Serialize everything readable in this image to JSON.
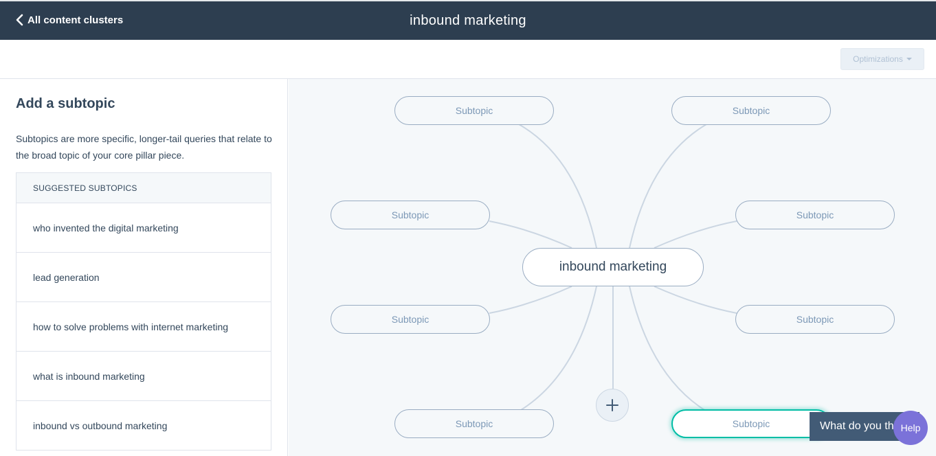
{
  "header": {
    "back_label": "All content clusters",
    "title": "inbound marketing"
  },
  "toolbar": {
    "optimizations_label": "Optimizations"
  },
  "panel": {
    "title": "Add a subtopic",
    "description": "Subtopics are more specific, longer-tail queries that relate to the broad topic of your core pillar piece.",
    "suggested_header": "SUGGESTED SUBTOPICS",
    "suggestions": [
      "who invented the digital marketing",
      "lead generation",
      "how to solve problems with internet marketing",
      "what is inbound marketing",
      "inbound vs outbound marketing"
    ]
  },
  "map": {
    "core_label": "inbound marketing",
    "subtopics": [
      "Subtopic",
      "Subtopic",
      "Subtopic",
      "Subtopic",
      "Subtopic",
      "Subtopic",
      "Subtopic",
      "Subtopic"
    ]
  },
  "widgets": {
    "feedback_label": "What do you think?",
    "help_label": "Help"
  },
  "colors": {
    "header_bg": "#2d3e50",
    "accent": "#00bda5",
    "help_bg": "#7b72d9"
  }
}
